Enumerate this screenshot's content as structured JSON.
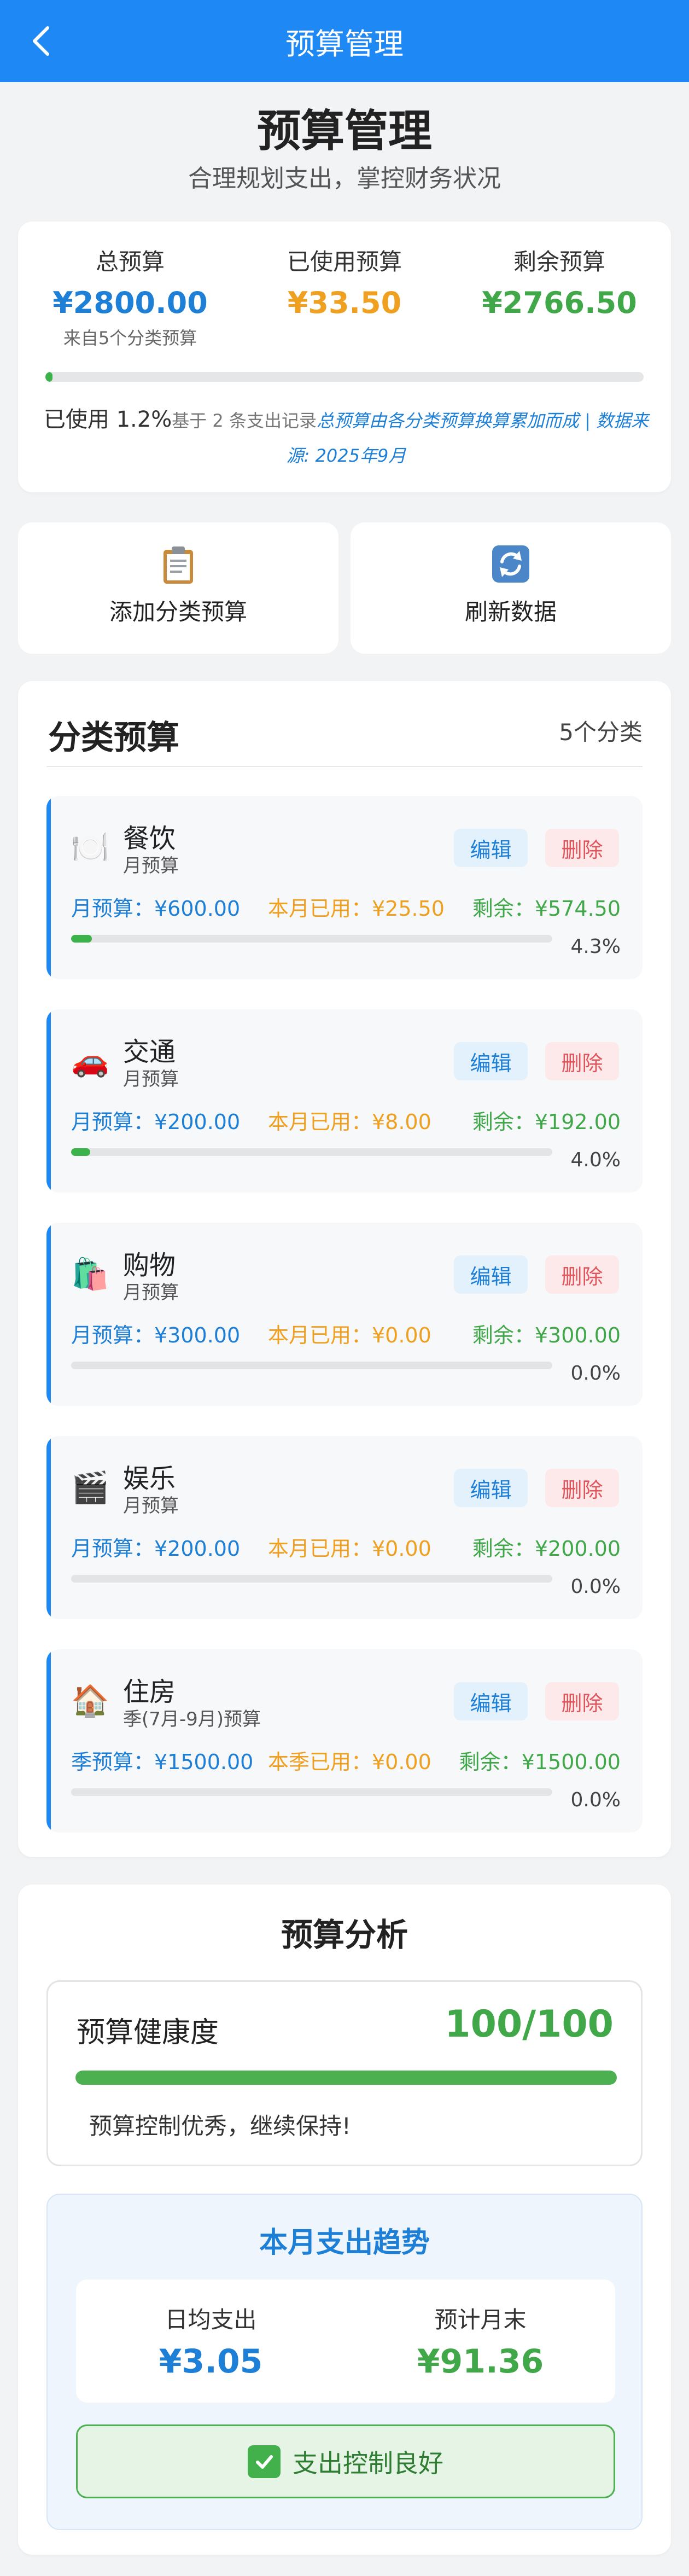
{
  "nav": {
    "title": "预算管理"
  },
  "header": {
    "title": "预算管理",
    "subtitle": "合理规划支出，掌控财务状况"
  },
  "summary": {
    "total_label": "总预算",
    "total_value": "¥2800.00",
    "total_note": "来自5个分类预算",
    "used_label": "已使用预算",
    "used_value": "¥33.50",
    "remain_label": "剩余预算",
    "remain_value": "¥2766.50",
    "progress": 1.2,
    "used_percent_text": "已使用 1.2%",
    "record_note": "基于 2 条支出记录",
    "source_note": "总预算由各分类预算换算累加而成 | 数据来源: 2025年9月"
  },
  "actions": {
    "add_label": "添加分类预算",
    "refresh_label": "刷新数据"
  },
  "categories": {
    "title": "分类预算",
    "count": "5个分类",
    "edit_label": "编辑",
    "delete_label": "删除",
    "items": [
      {
        "emoji": "🍽️",
        "name": "餐饮",
        "period": "月预算",
        "budget": "月预算：¥600.00",
        "used": "本月已用：¥25.50",
        "remain": "剩余：¥574.50",
        "progress": 4.3,
        "percent": "4.3%"
      },
      {
        "emoji": "🚗",
        "name": "交通",
        "period": "月预算",
        "budget": "月预算：¥200.00",
        "used": "本月已用：¥8.00",
        "remain": "剩余：¥192.00",
        "progress": 4.0,
        "percent": "4.0%"
      },
      {
        "emoji": "🛍️",
        "name": "购物",
        "period": "月预算",
        "budget": "月预算：¥300.00",
        "used": "本月已用：¥0.00",
        "remain": "剩余：¥300.00",
        "progress": 0,
        "percent": "0.0%"
      },
      {
        "emoji": "🎬",
        "name": "娱乐",
        "period": "月预算",
        "budget": "月预算：¥200.00",
        "used": "本月已用：¥0.00",
        "remain": "剩余：¥200.00",
        "progress": 0,
        "percent": "0.0%"
      },
      {
        "emoji": "🏠",
        "name": "住房",
        "period": "季(7月-9月)预算",
        "budget": "季预算：¥1500.00",
        "used": "本季已用：¥0.00",
        "remain": "剩余：¥1500.00",
        "progress": 0,
        "percent": "0.0%"
      }
    ]
  },
  "analysis": {
    "title": "预算分析",
    "health_label": "预算健康度",
    "health_score": "100/100",
    "health_progress": 100,
    "health_message": "预算控制优秀，继续保持!",
    "trend_title": "本月支出趋势",
    "daily_label": "日均支出",
    "daily_value": "¥3.05",
    "forecast_label": "预计月末",
    "forecast_value": "¥91.36",
    "status_text": "支出控制良好"
  },
  "colors": {
    "primary": "#1e88f5",
    "green": "#41a84a",
    "orange": "#f0a020",
    "red": "#e0565c"
  },
  "icons": {
    "back": "chevron-left-icon",
    "add": "clipboard-icon",
    "refresh": "refresh-icon",
    "status": "check-mark-icon"
  }
}
